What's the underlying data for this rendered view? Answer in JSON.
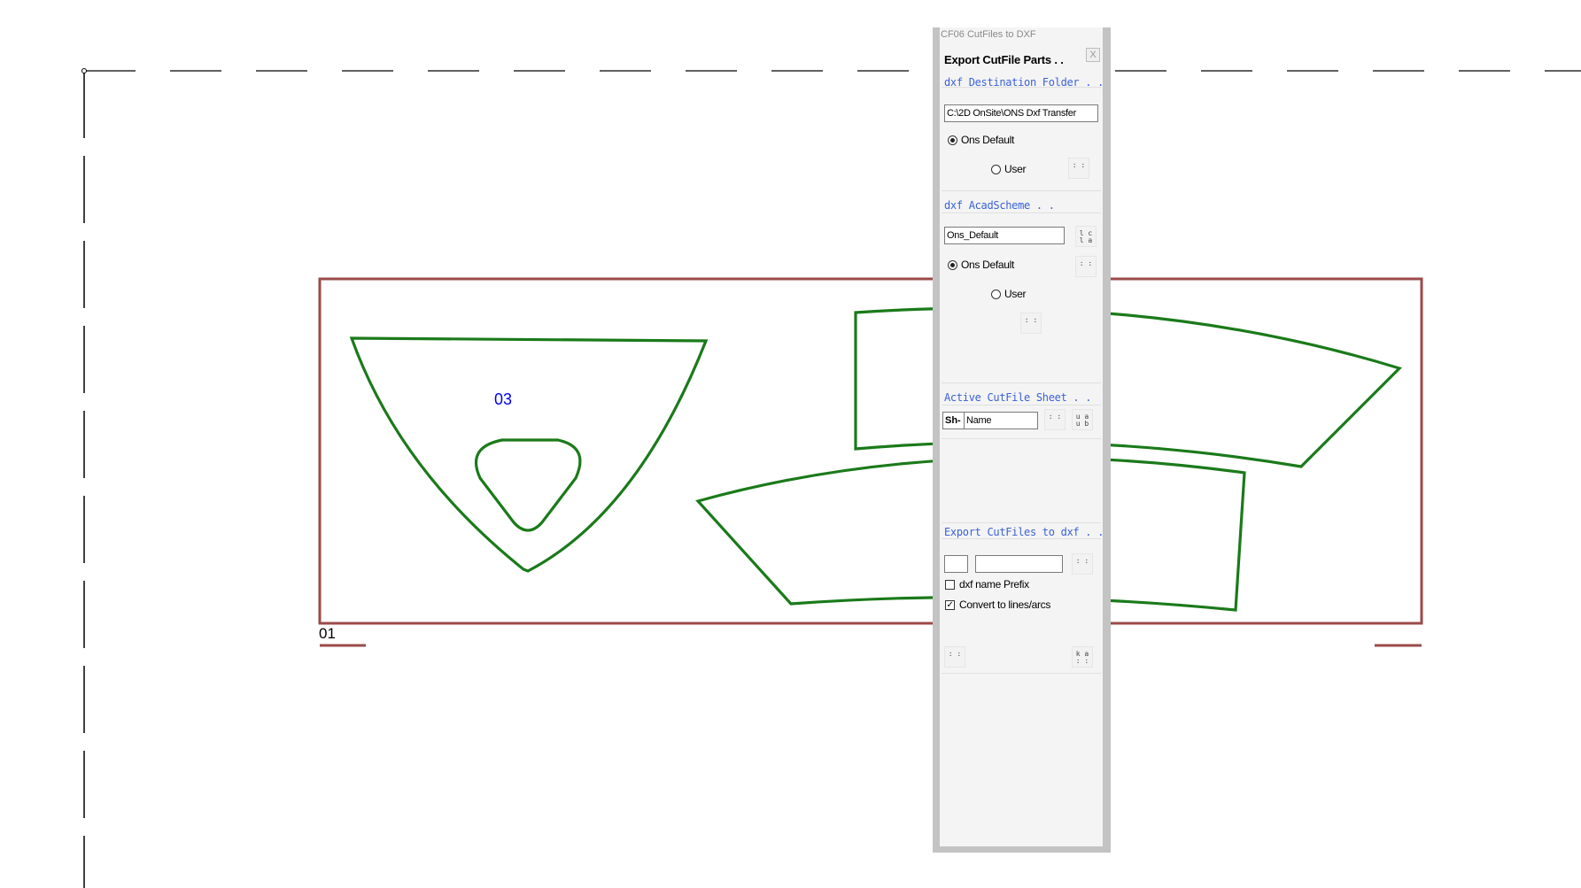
{
  "drawing": {
    "sheet_label": "01",
    "part_label": "03",
    "colors": {
      "sheet_border": "#9b4a4a",
      "part_stroke": "#1a7a1a",
      "part_label": "#0000ee",
      "dashed_frame": "#000000"
    }
  },
  "palette": {
    "title": "CF06 CutFiles to DXF",
    "close_label": "X",
    "header": "Export CutFile Parts . .",
    "destination": {
      "section_label": "dxf Destination Folder . .",
      "path_value": "C:\\2D OnSite\\ONS Dxf Transfer",
      "radio_default": "Ons Default",
      "radio_user": "User",
      "browse_button": ": :",
      "selected": "Ons Default"
    },
    "acad_scheme": {
      "section_label": "dxf AcadScheme . .",
      "scheme_value": "Ons_Default",
      "side_button": "l c\nl a",
      "radio_default": "Ons Default",
      "radio_user": "User",
      "btn_default": ": :",
      "btn_user": ": :",
      "selected": "Ons Default"
    },
    "active_sheet": {
      "section_label": "Active CutFile Sheet . .",
      "prefix": "Sh-",
      "name_value": "Name",
      "btn_pick": ": :",
      "btn_extra": "u a\nu b"
    },
    "export": {
      "section_label": "Export CutFiles to dxf . .",
      "field_small": "",
      "field_wide": "",
      "btn_pick": ": :",
      "prefix_label": "dxf name Prefix",
      "prefix_checked": false,
      "convert_label": "Convert to lines/arcs",
      "convert_checked": true,
      "btn_left": ": :",
      "btn_right": "k a\n: :"
    }
  }
}
